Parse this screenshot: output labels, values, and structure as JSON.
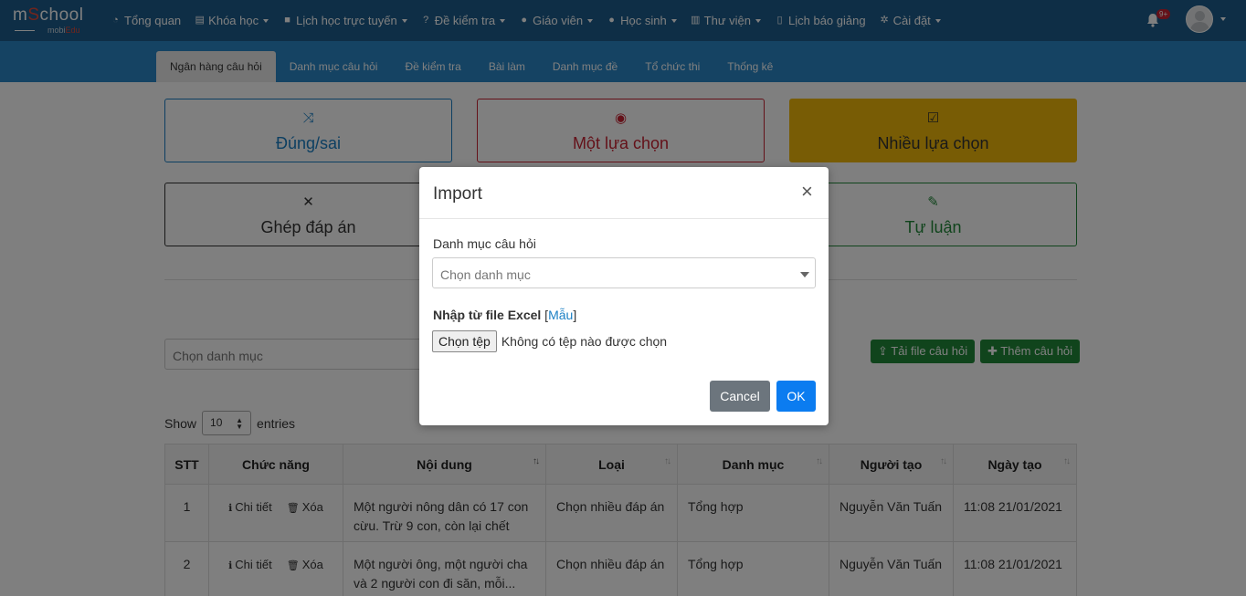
{
  "brand": {
    "logo_main_a": "m",
    "logo_main_o": "S",
    "logo_main_b": "chool",
    "logo_sub_a": "mobi",
    "logo_sub_b": "Edu"
  },
  "nav": [
    {
      "label": "Tổng quan",
      "icon": "dashboard-icon",
      "glyph": "◔",
      "caret": false
    },
    {
      "label": "Khóa học",
      "icon": "list-icon",
      "glyph": "▤",
      "caret": true
    },
    {
      "label": "Lịch học trực tuyến",
      "icon": "video-icon",
      "glyph": "■",
      "caret": true
    },
    {
      "label": "Đề kiểm tra",
      "icon": "question-icon",
      "glyph": "?",
      "caret": true
    },
    {
      "label": "Giáo viên",
      "icon": "users-icon",
      "glyph": "●",
      "caret": true
    },
    {
      "label": "Học sinh",
      "icon": "user-icon",
      "glyph": "●",
      "caret": true
    },
    {
      "label": "Thư viện",
      "icon": "book-icon",
      "glyph": "▥",
      "caret": true
    },
    {
      "label": "Lịch báo giảng",
      "icon": "clipboard-icon",
      "glyph": "▯",
      "caret": false
    },
    {
      "label": "Cài đặt",
      "icon": "gears-icon",
      "glyph": "✲",
      "caret": true
    }
  ],
  "notifications": {
    "badge": "9+"
  },
  "tabs": [
    "Ngân hàng câu hỏi",
    "Danh mục câu hỏi",
    "Đề kiểm tra",
    "Bài làm",
    "Danh mục đề",
    "Tổ chức thi",
    "Thống kê"
  ],
  "question_types": [
    {
      "label": "Đúng/sai",
      "icon": "shuffle-icon",
      "glyph": "⤨",
      "color": "#1a7fc4"
    },
    {
      "label": "Một lựa chọn",
      "icon": "radio-icon",
      "glyph": "◉",
      "color": "#c82333"
    },
    {
      "label": "Nhiều lựa chọn",
      "icon": "checkbox-icon",
      "glyph": "☑",
      "color": "#333333",
      "bg": "#f0b90b"
    },
    {
      "label": "Ghép đáp án",
      "icon": "expand-icon",
      "glyph": "✕",
      "color": "#333333"
    },
    {
      "label": "Tự luận",
      "icon": "edit-icon",
      "glyph": "✎",
      "color": "#218838"
    }
  ],
  "filter": {
    "placeholder": "Chọn danh mục"
  },
  "actions": {
    "upload": "Tải file câu hỏi",
    "add": "Thêm câu hỏi"
  },
  "length": {
    "show": "Show",
    "value": "10",
    "entries": "entries"
  },
  "table": {
    "columns": [
      "STT",
      "Chức năng",
      "Nội dung",
      "Loại",
      "Danh mục",
      "Người tạo",
      "Ngày tạo"
    ],
    "detail": "Chi tiết",
    "delete": "Xóa",
    "rows": [
      {
        "stt": "1",
        "content": "Một người nông dân có 17 con cừu. Trừ 9 con, còn lại chết hế...",
        "type": "Chọn nhiều đáp án",
        "category": "Tổng hợp",
        "creator": "Nguyễn Văn Tuấn",
        "date": "11:08 21/01/2021"
      },
      {
        "stt": "2",
        "content": "Một người ông, một người cha và 2 người con đi săn, mỗi...",
        "type": "Chọn nhiều đáp án",
        "category": "Tổng hợp",
        "creator": "Nguyễn Văn Tuấn",
        "date": "11:08 21/01/2021"
      }
    ]
  },
  "modal": {
    "title": "Import",
    "close": "×",
    "category_label": "Danh mục câu hỏi",
    "category_placeholder": "Chọn danh mục",
    "excel_label": "Nhập từ file Excel",
    "template_link": "Mẫu",
    "choose_file": "Chọn tệp",
    "no_file": "Không có tệp nào được chọn",
    "cancel": "Cancel",
    "ok": "OK"
  }
}
